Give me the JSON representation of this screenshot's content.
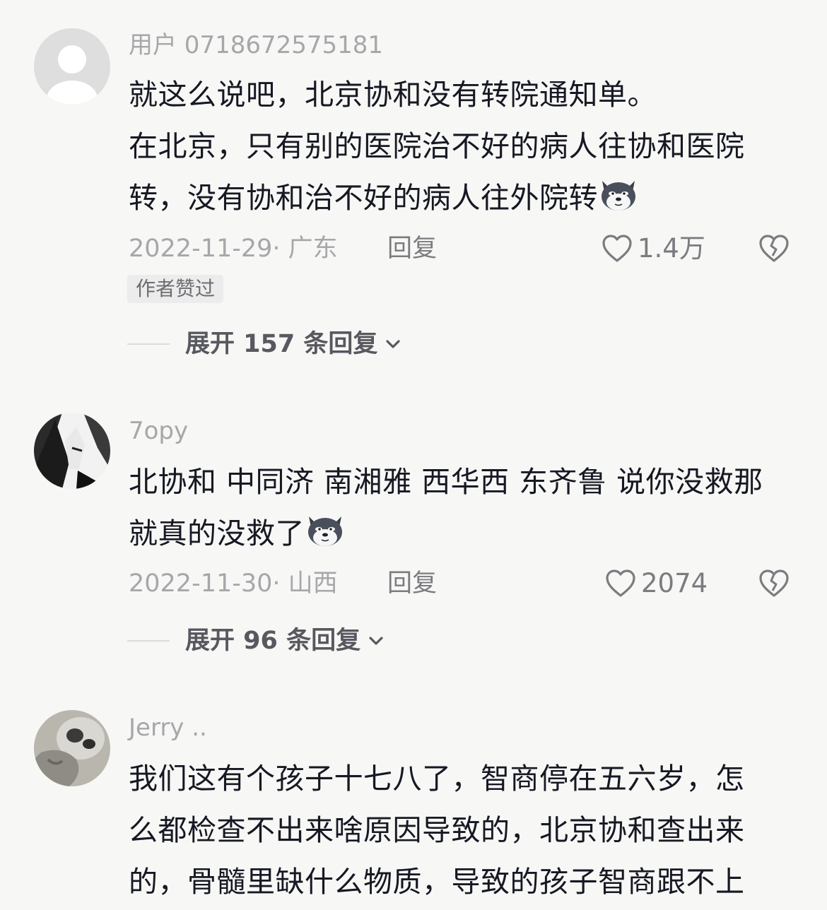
{
  "comments": [
    {
      "username": "用户 0718672575181",
      "lines": [
        "就这么说吧，北京协和没有转院通知单。",
        "在北京，只有别的医院治不好的病人往协和医院",
        "转，没有协和治不好的病人往外院转"
      ],
      "date_location": "2022-11-29· 广东",
      "reply_label": "回复",
      "likes": "1.4万",
      "badge": "作者赞过",
      "expand_label": "展开 157 条回复"
    },
    {
      "username": "7opy",
      "lines": [
        "北协和 中同济 南湘雅 西华西 东齐鲁 说你没救那",
        "就真的没救了"
      ],
      "date_location": "2022-11-30· 山西",
      "reply_label": "回复",
      "likes": "2074",
      "expand_label": "展开 96 条回复"
    },
    {
      "username": "Jerry  ..",
      "lines": [
        "我们这有个孩子十七八了，智商停在五六岁，怎",
        "么都检查不出来啥原因导致的，北京协和查出来",
        "的，骨髓里缺什么物质，导致的孩子智商跟不上"
      ]
    }
  ],
  "icons": {
    "heart": "heart-outline-icon",
    "dislike": "broken-heart-icon",
    "expand": "chevron-down-icon",
    "emoji": "husky-emoji"
  }
}
